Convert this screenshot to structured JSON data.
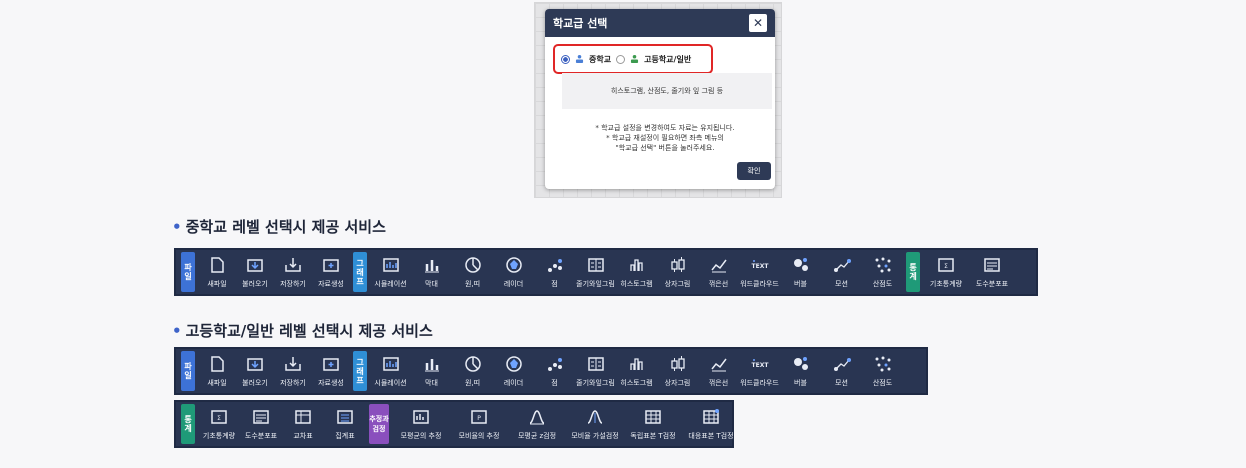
{
  "dialog": {
    "title": "학교급 선택",
    "close": "✕",
    "options": [
      {
        "label": "중학교",
        "selected": true,
        "icon": "blue-person-icon",
        "color": "#4a7fd6"
      },
      {
        "label": "고등학교/일반",
        "selected": false,
        "icon": "green-person-icon",
        "color": "#3c9a4f"
      }
    ],
    "description": "히스토그램, 산점도, 줄기와 잎 그림 등",
    "notes": [
      "* 학교급 설정을 변경하여도 자료는 유지됩니다.",
      "* 학교급 재설정이 필요하면 좌측 메뉴의",
      "\"학교급 선택\" 버튼을 눌러주세요."
    ],
    "ok": "확인"
  },
  "sections": [
    {
      "title": "중학교 레벨 선택시 제공 서비스"
    },
    {
      "title": "고등학교/일반 레벨 선택시 제공 서비스"
    }
  ],
  "groups": {
    "file": {
      "tag": "파일",
      "tools": [
        "새파일",
        "불러오기",
        "저장하기",
        "자료생성"
      ]
    },
    "graph": {
      "tag": "그래프",
      "tools": [
        "시뮬레이션",
        "막대",
        "원,띠",
        "레이더",
        "점",
        "줄기와잎그림",
        "히스토그램",
        "상자그림",
        "꺾은선",
        "워드클라우드",
        "버블",
        "모션",
        "산점도"
      ]
    },
    "stat_middle": {
      "tag": "통계",
      "tools": [
        "기초통계량",
        "도수분포표"
      ]
    },
    "stat_high": {
      "tag": "통계",
      "tools": [
        "기초통계량",
        "도수분포표",
        "교차표",
        "집계표"
      ]
    },
    "est": {
      "tag": "추정과검정",
      "tools": [
        "모평균의 추정",
        "모비율의 추정",
        "모평균 z검정",
        "모비율 가설검정",
        "독립표본 T검정",
        "대응표본 T검정"
      ]
    }
  },
  "colors": {
    "bar": "#293552",
    "file_tag": "#3d72d6",
    "graph_tag": "#2f8fd6",
    "stat_tag": "#1f9a78",
    "est_tag": "#8a4fbd",
    "accent": "#e02626"
  }
}
